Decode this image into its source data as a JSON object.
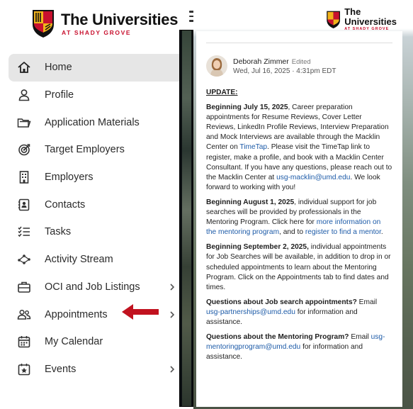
{
  "brand": {
    "title": "The Universities",
    "subtitle": "AT SHADY GROVE"
  },
  "nav": {
    "items": [
      {
        "label": "Home",
        "icon": "home-icon",
        "active": true,
        "has_submenu": false
      },
      {
        "label": "Profile",
        "icon": "user-icon",
        "active": false,
        "has_submenu": false
      },
      {
        "label": "Application Materials",
        "icon": "folder-icon",
        "active": false,
        "has_submenu": false
      },
      {
        "label": "Target Employers",
        "icon": "target-icon",
        "active": false,
        "has_submenu": false
      },
      {
        "label": "Employers",
        "icon": "building-icon",
        "active": false,
        "has_submenu": false
      },
      {
        "label": "Contacts",
        "icon": "contact-card-icon",
        "active": false,
        "has_submenu": false
      },
      {
        "label": "Tasks",
        "icon": "checklist-icon",
        "active": false,
        "has_submenu": false
      },
      {
        "label": "Activity Stream",
        "icon": "activity-icon",
        "active": false,
        "has_submenu": false
      },
      {
        "label": "OCI and Job Listings",
        "icon": "briefcase-icon",
        "active": false,
        "has_submenu": true
      },
      {
        "label": "Appointments",
        "icon": "people-icon",
        "active": false,
        "has_submenu": true
      },
      {
        "label": "My Calendar",
        "icon": "calendar-icon",
        "active": false,
        "has_submenu": false
      },
      {
        "label": "Events",
        "icon": "event-star-icon",
        "active": false,
        "has_submenu": true
      }
    ]
  },
  "post": {
    "author": "Deborah Zimmer",
    "edited": "Edited",
    "date": "Wed, Jul 16, 2025 · 4:31pm EDT",
    "heading": "UPDATE:",
    "p1": {
      "lead": "Beginning July 15, 2025",
      "t1": ", Career preparation appointments for Resume Reviews, Cover Letter Reviews, LinkedIn Profile Reviews, Interview Preparation and Mock Interviews are available through the Macklin Center on ",
      "link1": "TimeTap",
      "t2": ". Please visit the TimeTap link to register, make a profile, and book with a Macklin Center Consultant. If you have any questions, please reach out to the Macklin Center at ",
      "link2": "usg-macklin@umd.edu",
      "t3": ". We look forward to working with you!"
    },
    "p2": {
      "lead": "Beginning August 1, 2025",
      "t1": ", individual support for job searches will be provided by professionals in the Mentoring Program. Click here for ",
      "link1": "more information on the mentoring program",
      "t2": ", and to ",
      "link2": "register to find a mentor",
      "t3": "."
    },
    "p3": {
      "lead": "Beginning September 2, 2025,",
      "t1": " individual appointments for Job Searches will be available, in addition to drop in or scheduled appointments to learn about the Mentoring Program. Click on the Appointments tab to find dates and times."
    },
    "p4": {
      "lead": "Questions about Job search appointments?",
      "t1": " Email ",
      "link1": "usg-partnerships@umd.edu",
      "t2": " for information and assistance."
    },
    "p5": {
      "lead": "Questions about the Mentoring Program?",
      "t1": " Email ",
      "link1": "usg-mentoringprogram@umd.edu",
      "t2": " for information and assistance."
    }
  },
  "colors": {
    "brand_red": "#c8102e",
    "brand_gold": "#f2b31b",
    "arrow_red": "#c1121f",
    "link_blue": "#1d5ba8",
    "active_bg": "#e6e6e6"
  }
}
